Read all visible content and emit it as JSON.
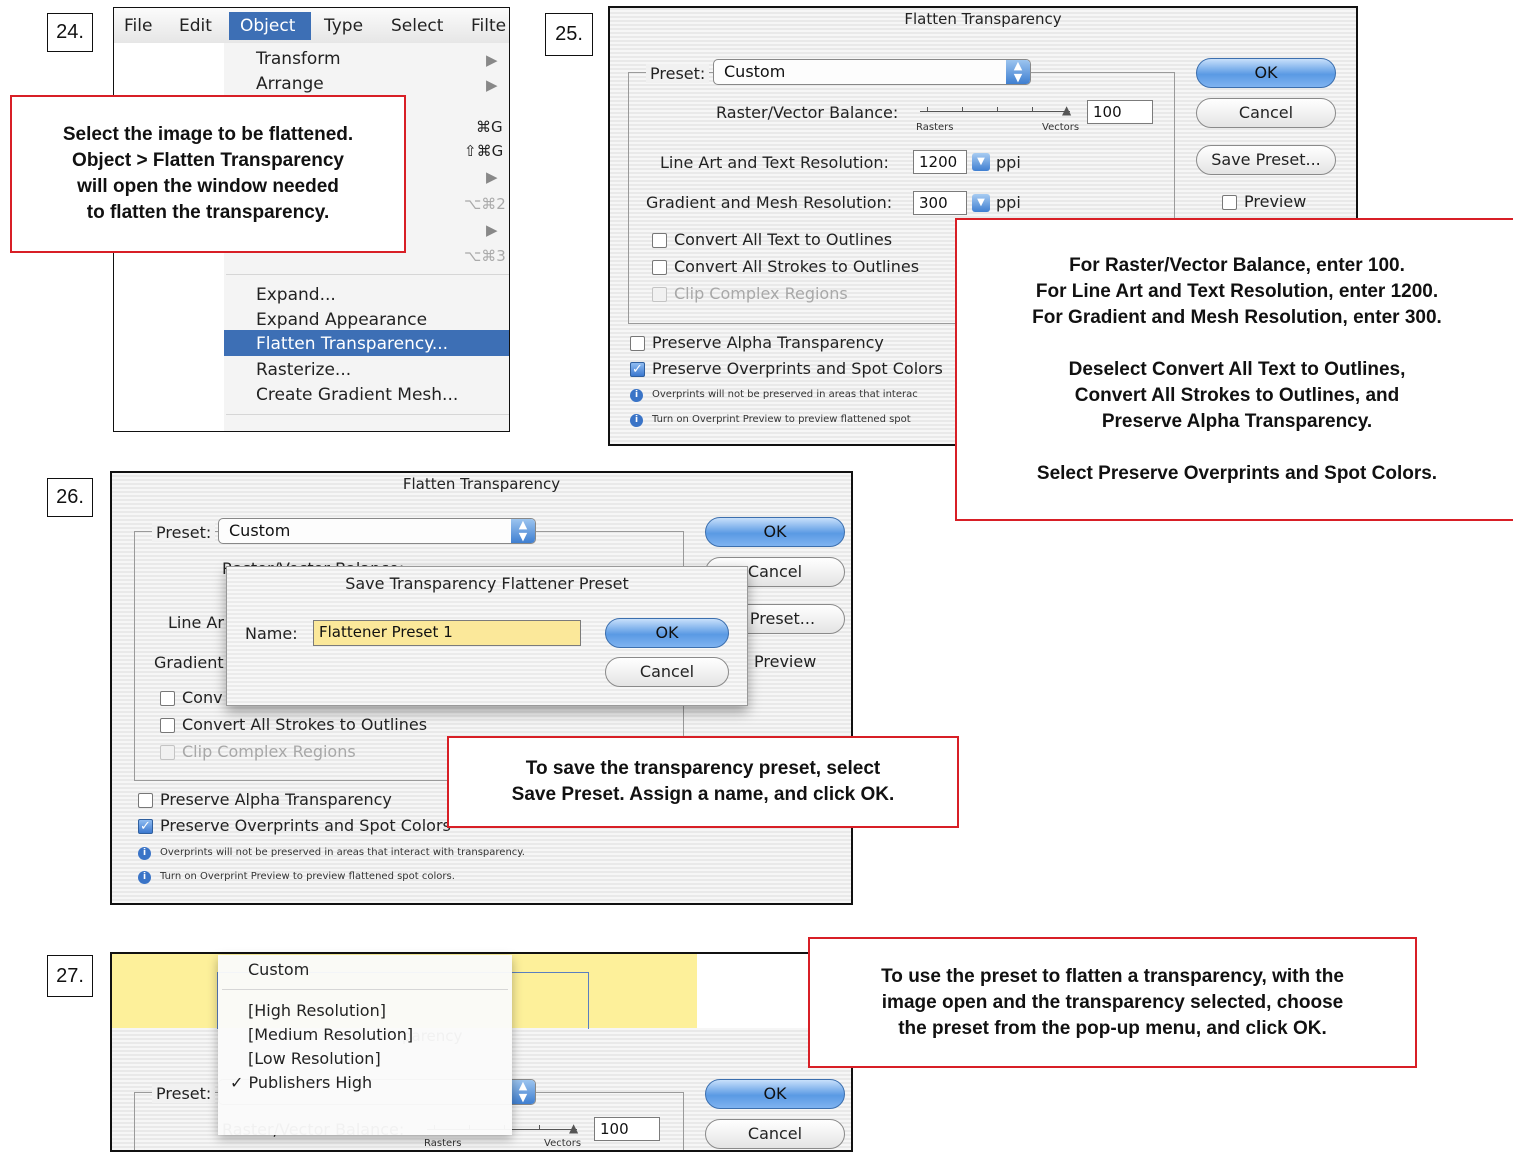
{
  "steps": {
    "s24": "24.",
    "s25": "25.",
    "s26": "26.",
    "s27": "27."
  },
  "panel24": {
    "menubar": [
      "File",
      "Edit",
      "Object",
      "Type",
      "Select",
      "Filte"
    ],
    "items": {
      "transform": "Transform",
      "arrange": "Arrange",
      "expand": "Expand...",
      "expand_appearance": "Expand Appearance",
      "flatten_transparency": "Flatten Transparency...",
      "rasterize": "Rasterize...",
      "create_gradient_mesh": "Create Gradient Mesh..."
    },
    "shortcuts": {
      "group": "⌘G",
      "ungroup": "⇧⌘G",
      "s2": "⌥⌘2",
      "s3": "⌥⌘3"
    },
    "callout": [
      "Select the image to be flattened.",
      "Object > Flatten Transparency",
      "will open the window needed",
      "to flatten the transparency."
    ]
  },
  "dialog": {
    "title": "Flatten Transparency",
    "preset_label": "Preset:",
    "preset_value": "Custom",
    "balance_label": "Raster/Vector Balance:",
    "balance_value": "100",
    "rasters": "Rasters",
    "vectors": "Vectors",
    "line_art_label": "Line Art and Text Resolution:",
    "line_art_value": "1200",
    "gradient_label": "Gradient and Mesh Resolution:",
    "gradient_value": "300",
    "ppi": "ppi",
    "convert_text": "Convert All Text to Outlines",
    "convert_strokes": "Convert All Strokes to Outlines",
    "clip_regions": "Clip Complex Regions",
    "preserve_alpha": "Preserve Alpha Transparency",
    "preserve_overprints": "Preserve Overprints and Spot Colors",
    "note1_25": "Overprints will not be preserved in areas that interac",
    "note2_25": "Turn on Overprint Preview to preview flattened spot",
    "note1": "Overprints will not be preserved in areas that interact with transparency.",
    "note2": "Turn on Overprint Preview to preview flattened spot colors.",
    "ok": "OK",
    "cancel": "Cancel",
    "save_preset": "Save Preset...",
    "preview": "Preview"
  },
  "panel25_callout": {
    "lines1": [
      "For Raster/Vector Balance, enter 100.",
      "For Line Art and Text Resolution, enter 1200.",
      "For Gradient and Mesh Resolution, enter 300."
    ],
    "lines2": [
      "Deselect Convert All Text to Outlines,",
      "Convert All Strokes to Outlines, and",
      "Preserve Alpha Transparency."
    ],
    "line3": "Select Preserve Overprints and Spot Colors."
  },
  "panel26": {
    "partial": {
      "balance": "Raster/Vector Balance:",
      "line_art": "Line Ar",
      "gradient": "Gradient",
      "conv": "Conv",
      "cancel": "Cancel",
      "save": "e Preset...",
      "preview": "Preview",
      "overprints": "Preserve Overprints and Spot Colors"
    },
    "sheet": {
      "title": "Save Transparency Flattener Preset",
      "name_label": "Name:",
      "name_value": "Flattener Preset 1",
      "ok": "OK",
      "cancel": "Cancel"
    },
    "callout": [
      "To save the transparency preset, select",
      "Save Preset. Assign a name, and click OK."
    ]
  },
  "panel27": {
    "menu": {
      "custom": "Custom",
      "high": "[High Resolution]",
      "medium": "[Medium Resolution]",
      "low": "[Low Resolution]",
      "publishers": "✓ Publishers High"
    },
    "title_fragment": "parency",
    "callout": [
      "To use the preset to flatten a transparency, with the",
      "image open and the transparency selected, choose",
      "the preset from the pop-up menu, and click OK."
    ]
  },
  "colors": {
    "callout_border": "#d81f26",
    "highlight": "#3d6fb5",
    "name_field": "#fbe89a",
    "yellow_art": "#fdf09a"
  }
}
